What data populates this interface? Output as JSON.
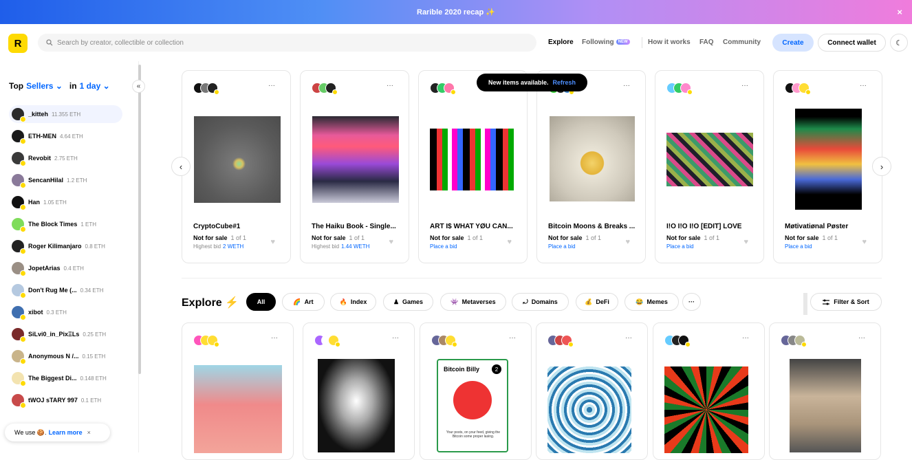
{
  "banner": {
    "text": "Rarible 2020 recap ✨",
    "close": "×"
  },
  "header": {
    "logo": "R",
    "search_placeholder": "Search by creator, collectible or collection",
    "nav": {
      "explore": "Explore",
      "following": "Following",
      "new_badge": "NEW",
      "how": "How it works",
      "faq": "FAQ",
      "community": "Community"
    },
    "create": "Create",
    "connect": "Connect wallet",
    "theme": "☾"
  },
  "sidebar": {
    "top": "Top",
    "sellers": "Sellers",
    "in": "in",
    "period": "1 day",
    "collapse": "«",
    "items": [
      {
        "name": "_kitteh",
        "eth": "11.355 ETH",
        "color": "#2b2b2b"
      },
      {
        "name": "ETH-MEN",
        "eth": "4.64 ETH",
        "color": "#1a1a1a"
      },
      {
        "name": "Revobit",
        "eth": "2.75 ETH",
        "color": "#3a3a3a"
      },
      {
        "name": "SencanHilal",
        "eth": "1.2 ETH",
        "color": "#8a7a9a"
      },
      {
        "name": "Han",
        "eth": "1.05 ETH",
        "color": "#111111"
      },
      {
        "name": "The Block Times",
        "eth": "1 ETH",
        "color": "#7fdc5a"
      },
      {
        "name": "Roger Kilimanjaro",
        "eth": "0.8 ETH",
        "color": "#222222"
      },
      {
        "name": "JopetArias",
        "eth": "0.4 ETH",
        "color": "#9a8f85"
      },
      {
        "name": "Don't Rug Me (...",
        "eth": "0.34 ETH",
        "color": "#b5c9e0"
      },
      {
        "name": "xibot",
        "eth": "0.3 ETH",
        "color": "#3f6fb0"
      },
      {
        "name": "SiLvi0_in_PixΞLs",
        "eth": "0.25 ETH",
        "color": "#7a2a2a"
      },
      {
        "name": "Anonymous N /...",
        "eth": "0.15 ETH",
        "color": "#c9b48a"
      },
      {
        "name": "The Biggest Di...",
        "eth": "0.148 ETH",
        "color": "#f3e3b0"
      },
      {
        "name": "tWOJ sTARY 997",
        "eth": "0.1 ETH",
        "color": "#c84a4a"
      }
    ]
  },
  "cookie": {
    "text": "We use 🍪.",
    "learn": "Learn more",
    "close": "×"
  },
  "toast": {
    "text": "New items available.",
    "refresh": "Refresh"
  },
  "carousel": {
    "prev": "‹",
    "next": "›",
    "items": [
      {
        "title": "CryptoCube#1",
        "sale": "Not for sale",
        "of": "1 of 1",
        "bid_label": "Highest bid",
        "bid_value": "2 WETH"
      },
      {
        "title": "The Haiku Book - Single...",
        "sale": "Not for sale",
        "of": "1 of 1",
        "bid_label": "Highest bid",
        "bid_value": "1.44 WETH"
      },
      {
        "title": "ART I$ WHAT YØU CAN...",
        "sale": "Not for sale",
        "of": "1 of 1",
        "bid_label": "Place a bid",
        "bid_value": ""
      },
      {
        "title": "Bitcoin Moons & Breaks ...",
        "sale": "Not for sale",
        "of": "1 of 1",
        "bid_label": "Place a bid",
        "bid_value": ""
      },
      {
        "title": "I!O I!O I!O [EDIT] LOVE",
        "sale": "Not for sale",
        "of": "1 of 1",
        "bid_label": "Place a bid",
        "bid_value": ""
      },
      {
        "title": "Møtivatiønal Pøster",
        "sale": "Not for sale",
        "of": "1 of 1",
        "bid_label": "Place a bid",
        "bid_value": ""
      }
    ]
  },
  "explore": {
    "title": "Explore",
    "icon": "⚡",
    "filters": [
      {
        "icon": "",
        "label": "All"
      },
      {
        "icon": "🌈",
        "label": "Art"
      },
      {
        "icon": "🔥",
        "label": "Index"
      },
      {
        "icon": "♟",
        "label": "Games"
      },
      {
        "icon": "👾",
        "label": "Metaverses"
      },
      {
        "icon": "⤾",
        "label": "Domains"
      },
      {
        "icon": "💰",
        "label": "DeFi"
      },
      {
        "icon": "😂",
        "label": "Memes"
      },
      {
        "icon": "···",
        "label": ""
      }
    ],
    "filter_sort": "Filter & Sort",
    "card_art_text": {
      "title": "Bitcoin Billy",
      "num": "2",
      "desc": "Your posts, on your feed, giving the Bitcoin some proper lasing."
    }
  },
  "more": "···",
  "heart": "♥",
  "colors": {
    "accent": "#0066ff",
    "yellow": "#feda03"
  }
}
